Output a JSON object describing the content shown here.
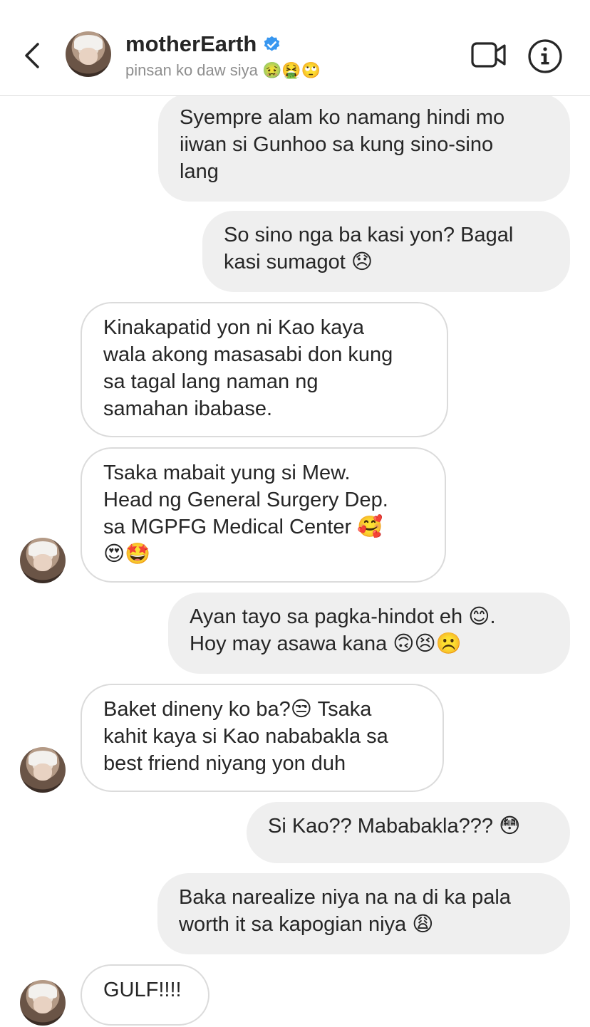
{
  "header": {
    "username": "motherEarth",
    "subtitle": "pinsan ko daw siya 🤢🤮🙄",
    "verified_color": "#3897f0"
  },
  "icons": {
    "back": "chevron-left-icon",
    "video": "video-camera-icon",
    "info": "info-circle-icon",
    "verified": "verified-badge-icon"
  },
  "messages": [
    {
      "dir": "out",
      "text": "Syempre alam ko namang hindi mo\niiwan si Gunhoo sa kung sino-sino\nlang"
    },
    {
      "dir": "out",
      "text": "So sino nga ba kasi yon? Bagal\nkasi sumagot 😞"
    },
    {
      "dir": "in",
      "text": "Kinakapatid yon ni Kao kaya\nwala akong masasabi don kung\nsa tagal lang naman ng\nsamahan ibabase."
    },
    {
      "dir": "in",
      "text": "Tsaka mabait yung si Mew.\nHead ng General Surgery Dep.\nsa MGPFG Medical Center 🥰\n😍🤩"
    },
    {
      "dir": "out",
      "text": "Ayan tayo sa pagka-hindot eh 😊.\nHoy may asawa kana 🙃😣☹️"
    },
    {
      "dir": "in",
      "text": "Baket dineny ko ba?😒 Tsaka\nkahit kaya si Kao nababakla sa\nbest friend niyang yon duh"
    },
    {
      "dir": "out",
      "text": "Si Kao?? Mababakla??? 😳"
    },
    {
      "dir": "out",
      "text": "Baka narealize niya na na di ka pala\nworth it sa kapogian niya 😩"
    },
    {
      "dir": "in",
      "text": "GULF!!!!"
    }
  ]
}
